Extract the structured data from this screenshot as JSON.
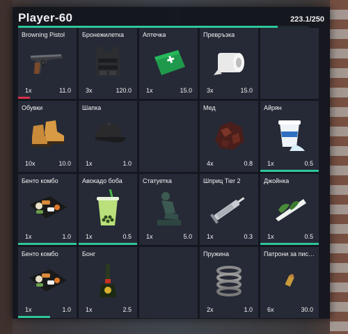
{
  "header": {
    "player_name": "Player-60",
    "weight_text": "223.1/250",
    "weight_fraction": 0.892
  },
  "colors": {
    "accent": "#2ec69a",
    "damage": "#d8324a"
  },
  "slots": [
    {
      "name": "Browning Pistol",
      "qty": "1x",
      "weight": "11.0",
      "icon": "pistol-icon",
      "bar_color": "#d8324a",
      "bar_fraction": 0.2
    },
    {
      "name": "Бронежилетка",
      "qty": "3x",
      "weight": "120.0",
      "icon": "armor-vest-icon"
    },
    {
      "name": "Аптечка",
      "qty": "1x",
      "weight": "15.0",
      "icon": "first-aid-kit-icon"
    },
    {
      "name": "Превръзка",
      "qty": "3x",
      "weight": "15.0",
      "icon": "bandage-roll-icon"
    },
    {
      "name": "",
      "qty": "",
      "weight": "",
      "icon": ""
    },
    {
      "name": "Обувки",
      "qty": "10x",
      "weight": "10.0",
      "icon": "boots-icon"
    },
    {
      "name": "Шапка",
      "qty": "1x",
      "weight": "1.0",
      "icon": "cap-icon"
    },
    {
      "name": "",
      "qty": "",
      "weight": "",
      "icon": ""
    },
    {
      "name": "Мед",
      "qty": "4x",
      "weight": "0.8",
      "icon": "honey-comb-icon"
    },
    {
      "name": "Айрян",
      "qty": "1x",
      "weight": "0.5",
      "icon": "ayran-cup-icon",
      "bar_color": "#2ec69a",
      "bar_fraction": 1.0
    },
    {
      "name": "Бенто комбо",
      "qty": "1x",
      "weight": "1.0",
      "icon": "bento-box-icon",
      "bar_color": "#2ec69a",
      "bar_fraction": 1.0
    },
    {
      "name": "Авокадо боба",
      "qty": "1x",
      "weight": "0.5",
      "icon": "bubble-tea-icon",
      "bar_color": "#2ec69a",
      "bar_fraction": 1.0
    },
    {
      "name": "Статуетка",
      "qty": "1x",
      "weight": "5.0",
      "icon": "thinker-statue-icon"
    },
    {
      "name": "Шприц Tier 2",
      "qty": "1x",
      "weight": "0.3",
      "icon": "syringe-icon"
    },
    {
      "name": "Джойнка",
      "qty": "1x",
      "weight": "0.5",
      "icon": "joint-icon",
      "bar_color": "#2ec69a",
      "bar_fraction": 1.0
    },
    {
      "name": "Бенто комбо",
      "qty": "1x",
      "weight": "1.0",
      "icon": "bento-box-icon",
      "bar_color": "#2ec69a",
      "bar_fraction": 0.55
    },
    {
      "name": "Бонг",
      "qty": "1x",
      "weight": "2.5",
      "icon": "bong-icon"
    },
    {
      "name": "",
      "qty": "",
      "weight": "",
      "icon": ""
    },
    {
      "name": "Пружина",
      "qty": "2x",
      "weight": "1.0",
      "icon": "spring-coil-icon"
    },
    {
      "name": "Патрони за пис…",
      "qty": "6x",
      "weight": "30.0",
      "icon": "pistol-ammo-icon"
    }
  ]
}
